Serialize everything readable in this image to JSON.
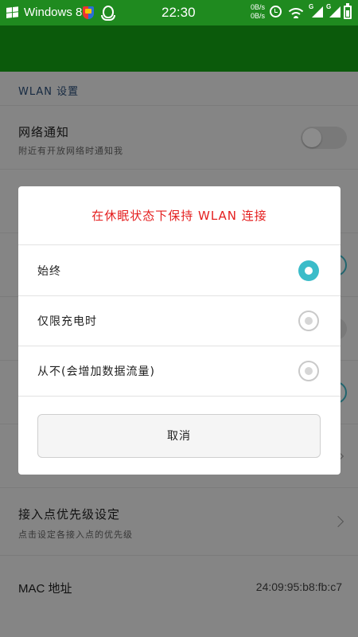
{
  "status_bar": {
    "carrier": "Windows 8",
    "time": "22:30",
    "up_rate": "0B/s",
    "down_rate": "0B/s",
    "signal_1_type": "G",
    "signal_2_type": "G"
  },
  "section_header": "WLAN 设置",
  "rows": {
    "network_notify": {
      "title": "网络通知",
      "subtitle": "附近有开放网络时通知我"
    },
    "ap_priority": {
      "title": "接入点优先级设定",
      "subtitle": "点击设定各接入点的优先级"
    },
    "mac": {
      "label": "MAC 地址",
      "value": "24:09:95:b8:fb:c7"
    }
  },
  "dialog": {
    "title": "在休眠状态下保持 WLAN 连接",
    "options": [
      {
        "label": "始终",
        "checked": true
      },
      {
        "label": "仅限充电时",
        "checked": false
      },
      {
        "label": "从不(会增加数据流量)",
        "checked": false
      }
    ],
    "cancel_label": "取消"
  },
  "colors": {
    "status_bar": "#1f8a1f",
    "header_band": "#0b5a0b",
    "accent": "#3bbcc9",
    "dialog_title": "#e41e1e"
  }
}
